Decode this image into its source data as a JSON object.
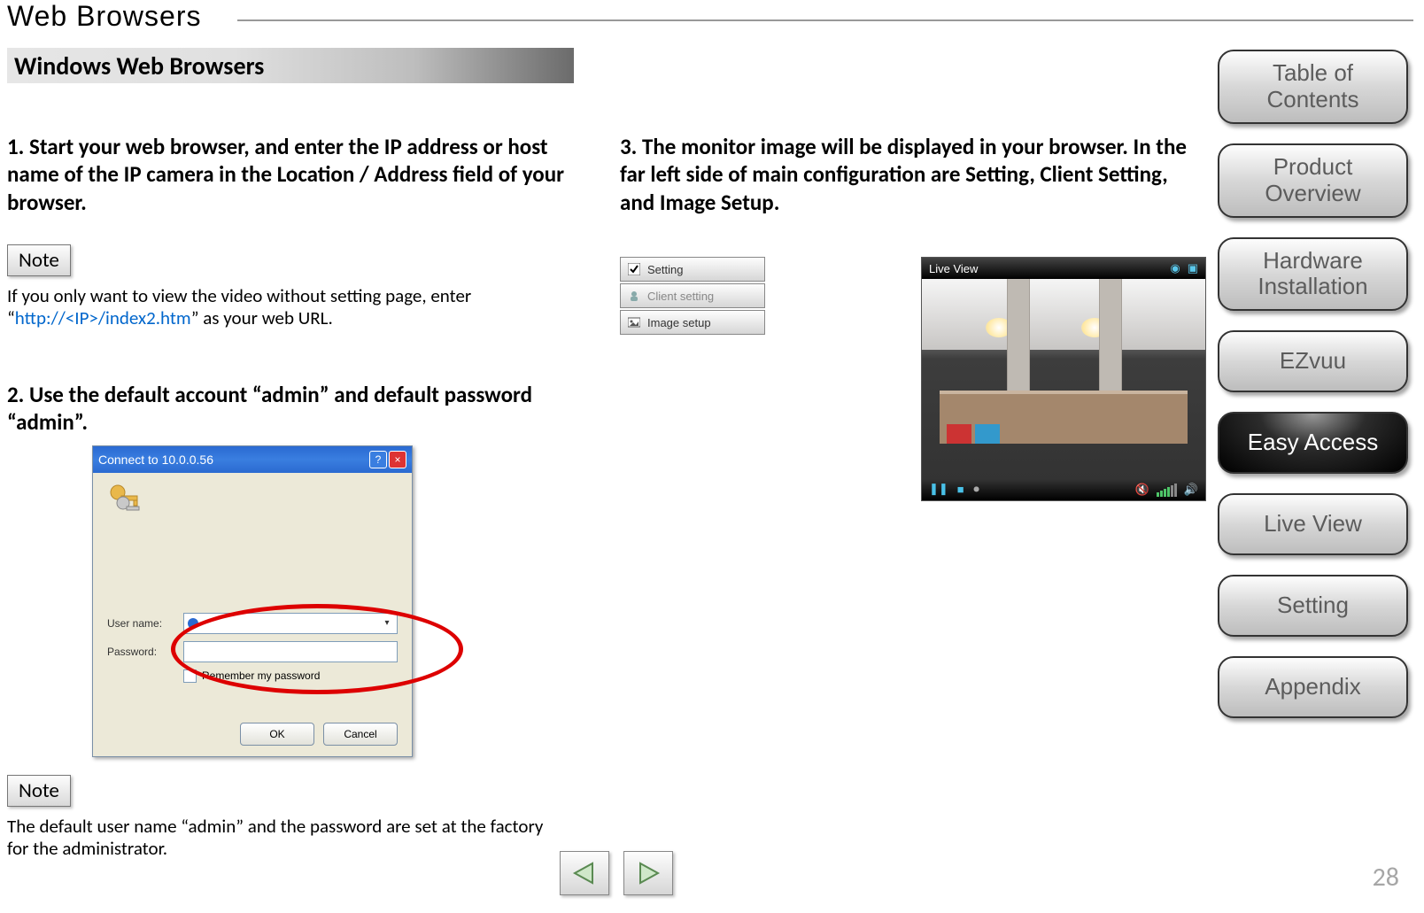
{
  "page_title": "Web Browsers",
  "section_heading": "Windows Web Browsers",
  "steps": {
    "s1": "1. Start your web browser, and enter the IP address or host name of the IP camera in the Location / Address field of your browser.",
    "s2": "2. Use the default account “admin” and default password “admin”.",
    "s3": "3. The monitor image will be displayed in your browser. In the far left side of main configuration are Setting, Client Setting, and Image Setup."
  },
  "note_label": "Note",
  "note1_prefix": "If you only want to view the video without setting page, enter “",
  "note1_link": "http://<IP>/index2.htm",
  "note1_suffix": "” as your web URL.",
  "note2_text": "The default user name “admin” and the password are set at the factory for the administrator.",
  "login_dialog": {
    "title": "Connect to 10.0.0.56",
    "username_label": "User name:",
    "password_label": "Password:",
    "remember_label": "Remember my password",
    "ok": "OK",
    "cancel": "Cancel"
  },
  "panel": {
    "setting": "Setting",
    "client": "Client setting",
    "image": "Image setup"
  },
  "liveview": {
    "title": "Live View"
  },
  "sidebar": {
    "items": [
      {
        "label_line1": "Table of",
        "label_line2": "Contents"
      },
      {
        "label_line1": "Product",
        "label_line2": "Overview"
      },
      {
        "label_line1": "Hardware",
        "label_line2": "Installation"
      },
      {
        "label": "EZvuu"
      },
      {
        "label": "Easy Access",
        "active": true
      },
      {
        "label": "Live View"
      },
      {
        "label": "Setting"
      },
      {
        "label": "Appendix"
      }
    ]
  },
  "page_number": "28"
}
